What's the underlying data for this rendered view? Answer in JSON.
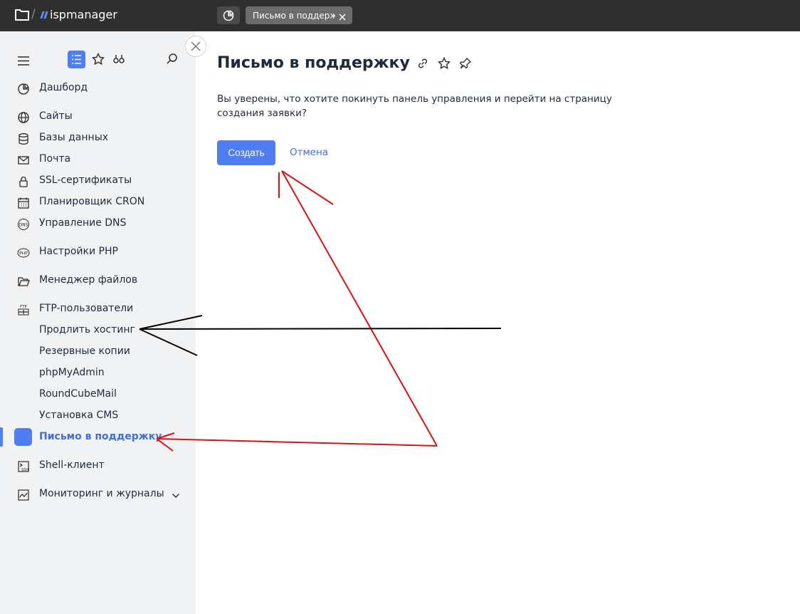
{
  "topbar": {
    "logo_text": "ispmanager",
    "active_tab_label": "Письмо в поддерж...",
    "icons": {
      "folder": "folder-icon",
      "dashboard": "pie-chart-icon",
      "close": "close-icon"
    }
  },
  "sidebar": {
    "items": [
      {
        "label": "Дашборд",
        "icon": "pie-chart-icon"
      },
      {
        "label": "Сайты",
        "icon": "globe-icon"
      },
      {
        "label": "Базы данных",
        "icon": "database-icon"
      },
      {
        "label": "Почта",
        "icon": "mail-icon"
      },
      {
        "label": "SSL-сертификаты",
        "icon": "lock-icon"
      },
      {
        "label": "Планировщик CRON",
        "icon": "calendar-icon"
      },
      {
        "label": "Управление DNS",
        "icon": "dns-icon"
      },
      {
        "label": "Настройки PHP",
        "icon": "php-icon"
      },
      {
        "label": "Менеджер файлов",
        "icon": "folder-open-icon"
      },
      {
        "label": "FTP-пользователи",
        "icon": "ftp-icon"
      },
      {
        "label": "Продлить хостинг",
        "icon": ""
      },
      {
        "label": "Резервные копии",
        "icon": ""
      },
      {
        "label": "phpMyAdmin",
        "icon": ""
      },
      {
        "label": "RoundCubeMail",
        "icon": ""
      },
      {
        "label": "Установка CMS",
        "icon": ""
      },
      {
        "label": "Письмо в поддержку",
        "icon": "",
        "active": true
      },
      {
        "label": "Shell-клиент",
        "icon": "ssh-icon"
      },
      {
        "label": "Мониторинг и журналы",
        "icon": "chart-icon"
      }
    ],
    "icon_texts": {
      "dns": "DNS",
      "php": "PHP",
      "ftp": "FTP",
      "ssh": "SSH"
    }
  },
  "main": {
    "title": "Письмо в поддержку",
    "message": "Вы уверены, что хотите покинуть панель управления и перейти на страницу создания заявки?",
    "create_label": "Создать",
    "cancel_label": "Отмена"
  },
  "colors": {
    "accent": "#4e7ef2",
    "topbar_bg": "#2f2f2f",
    "sidebar_bg": "#f1f2f3",
    "annotation_red": "#e01010",
    "annotation_black": "#000000"
  }
}
